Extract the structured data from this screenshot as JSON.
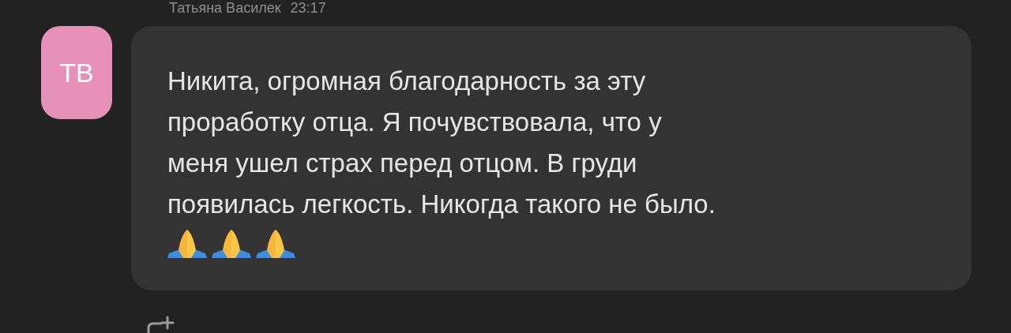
{
  "message": {
    "author": "Татьяна Василек",
    "time": "23:17",
    "avatar_initials": "ТВ",
    "lines": [
      "Никита, огромная благодарность за эту",
      "проработку отца. Я почувствовала, что у",
      "меня ушел страх перед отцом. В груди",
      "появилась легкость. Никогда такого не было."
    ]
  }
}
